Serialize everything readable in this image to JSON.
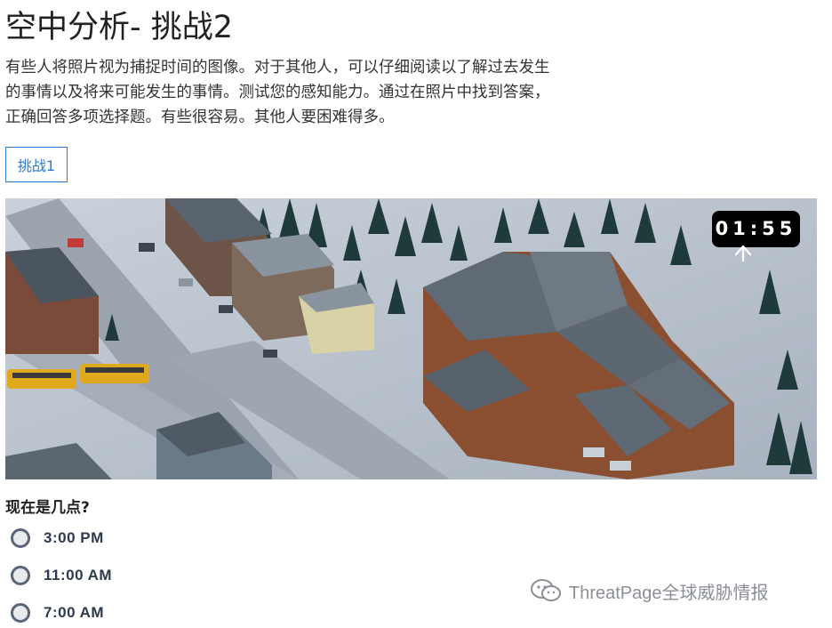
{
  "page": {
    "title": "空中分析- 挑战2",
    "description_lines": [
      "有些人将照片视为捕捉时间的图像。对于其他人，可以仔细阅读以了解过去发生",
      "的事情以及将来可能发生的事情。测试您的感知能力。通过在照片中找到答案，",
      "正确回答多项选择题。有些很容易。其他人要困难得多。"
    ]
  },
  "nav": {
    "challenge_button_label": "挑战1"
  },
  "scene": {
    "image_icon": "aerial-ski-resort-town-image",
    "timer_text": "01:55",
    "cursor_icon": "cursor-arrow-icon"
  },
  "quiz": {
    "question": "现在是几点?",
    "options": [
      {
        "label": "3:00 PM"
      },
      {
        "label": "11:00 AM"
      },
      {
        "label": "7:00 AM"
      }
    ]
  },
  "watermark": {
    "text": "ThreatPage全球威胁情报",
    "icon": "wechat-icon"
  },
  "colors": {
    "accent": "#2b7bd0",
    "timer_bg": "#000000",
    "radio_border": "#5b6577",
    "option_text": "#2d3a4d"
  }
}
